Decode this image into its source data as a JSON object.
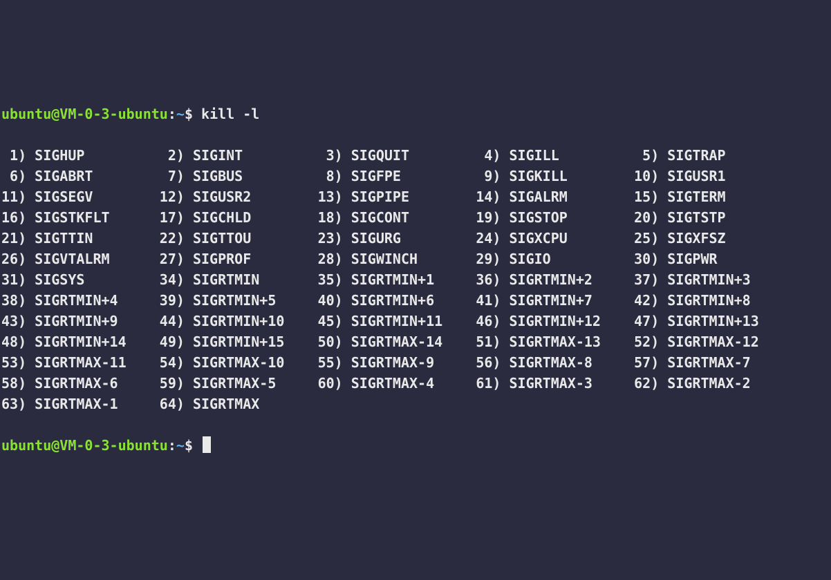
{
  "prompt": {
    "user": "ubuntu",
    "at": "@",
    "host": "VM-0-3-ubuntu",
    "colon": ":",
    "path": "~",
    "dollar": "$",
    "space": " ",
    "command": "kill -l"
  },
  "signals": [
    {
      "n": "1",
      "name": "SIGHUP"
    },
    {
      "n": "2",
      "name": "SIGINT"
    },
    {
      "n": "3",
      "name": "SIGQUIT"
    },
    {
      "n": "4",
      "name": "SIGILL"
    },
    {
      "n": "5",
      "name": "SIGTRAP"
    },
    {
      "n": "6",
      "name": "SIGABRT"
    },
    {
      "n": "7",
      "name": "SIGBUS"
    },
    {
      "n": "8",
      "name": "SIGFPE"
    },
    {
      "n": "9",
      "name": "SIGKILL"
    },
    {
      "n": "10",
      "name": "SIGUSR1"
    },
    {
      "n": "11",
      "name": "SIGSEGV"
    },
    {
      "n": "12",
      "name": "SIGUSR2"
    },
    {
      "n": "13",
      "name": "SIGPIPE"
    },
    {
      "n": "14",
      "name": "SIGALRM"
    },
    {
      "n": "15",
      "name": "SIGTERM"
    },
    {
      "n": "16",
      "name": "SIGSTKFLT"
    },
    {
      "n": "17",
      "name": "SIGCHLD"
    },
    {
      "n": "18",
      "name": "SIGCONT"
    },
    {
      "n": "19",
      "name": "SIGSTOP"
    },
    {
      "n": "20",
      "name": "SIGTSTP"
    },
    {
      "n": "21",
      "name": "SIGTTIN"
    },
    {
      "n": "22",
      "name": "SIGTTOU"
    },
    {
      "n": "23",
      "name": "SIGURG"
    },
    {
      "n": "24",
      "name": "SIGXCPU"
    },
    {
      "n": "25",
      "name": "SIGXFSZ"
    },
    {
      "n": "26",
      "name": "SIGVTALRM"
    },
    {
      "n": "27",
      "name": "SIGPROF"
    },
    {
      "n": "28",
      "name": "SIGWINCH"
    },
    {
      "n": "29",
      "name": "SIGIO"
    },
    {
      "n": "30",
      "name": "SIGPWR"
    },
    {
      "n": "31",
      "name": "SIGSYS"
    },
    {
      "n": "34",
      "name": "SIGRTMIN"
    },
    {
      "n": "35",
      "name": "SIGRTMIN+1"
    },
    {
      "n": "36",
      "name": "SIGRTMIN+2"
    },
    {
      "n": "37",
      "name": "SIGRTMIN+3"
    },
    {
      "n": "38",
      "name": "SIGRTMIN+4"
    },
    {
      "n": "39",
      "name": "SIGRTMIN+5"
    },
    {
      "n": "40",
      "name": "SIGRTMIN+6"
    },
    {
      "n": "41",
      "name": "SIGRTMIN+7"
    },
    {
      "n": "42",
      "name": "SIGRTMIN+8"
    },
    {
      "n": "43",
      "name": "SIGRTMIN+9"
    },
    {
      "n": "44",
      "name": "SIGRTMIN+10"
    },
    {
      "n": "45",
      "name": "SIGRTMIN+11"
    },
    {
      "n": "46",
      "name": "SIGRTMIN+12"
    },
    {
      "n": "47",
      "name": "SIGRTMIN+13"
    },
    {
      "n": "48",
      "name": "SIGRTMIN+14"
    },
    {
      "n": "49",
      "name": "SIGRTMIN+15"
    },
    {
      "n": "50",
      "name": "SIGRTMAX-14"
    },
    {
      "n": "51",
      "name": "SIGRTMAX-13"
    },
    {
      "n": "52",
      "name": "SIGRTMAX-12"
    },
    {
      "n": "53",
      "name": "SIGRTMAX-11"
    },
    {
      "n": "54",
      "name": "SIGRTMAX-10"
    },
    {
      "n": "55",
      "name": "SIGRTMAX-9"
    },
    {
      "n": "56",
      "name": "SIGRTMAX-8"
    },
    {
      "n": "57",
      "name": "SIGRTMAX-7"
    },
    {
      "n": "58",
      "name": "SIGRTMAX-6"
    },
    {
      "n": "59",
      "name": "SIGRTMAX-5"
    },
    {
      "n": "60",
      "name": "SIGRTMAX-4"
    },
    {
      "n": "61",
      "name": "SIGRTMAX-3"
    },
    {
      "n": "62",
      "name": "SIGRTMAX-2"
    },
    {
      "n": "63",
      "name": "SIGRTMAX-1"
    },
    {
      "n": "64",
      "name": "SIGRTMAX"
    }
  ]
}
